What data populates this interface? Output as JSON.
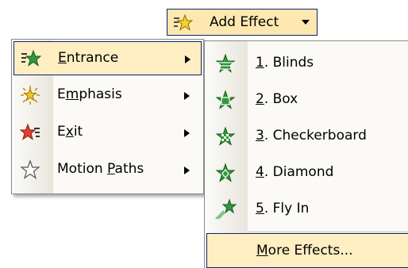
{
  "add_effect": {
    "label": "Add Effect",
    "icon": "add-effect-star-icon"
  },
  "main_menu": {
    "items": [
      {
        "pre": "",
        "key": "E",
        "post": "ntrance",
        "icon": "entrance-star-icon",
        "has_submenu": true,
        "selected": true
      },
      {
        "pre": "E",
        "key": "m",
        "post": "phasis",
        "icon": "emphasis-star-icon",
        "has_submenu": true,
        "selected": false
      },
      {
        "pre": "E",
        "key": "x",
        "post": "it",
        "icon": "exit-star-icon",
        "has_submenu": true,
        "selected": false
      },
      {
        "pre": "Motion ",
        "key": "P",
        "post": "aths",
        "icon": "motion-path-star-icon",
        "has_submenu": true,
        "selected": false
      }
    ]
  },
  "sub_menu": {
    "items": [
      {
        "key": "1",
        "post": ". Blinds",
        "icon": "blinds-effect-icon"
      },
      {
        "key": "2",
        "post": ". Box",
        "icon": "box-effect-icon"
      },
      {
        "key": "3",
        "post": ". Checkerboard",
        "icon": "checkerboard-effect-icon"
      },
      {
        "key": "4",
        "post": ". Diamond",
        "icon": "diamond-effect-icon"
      },
      {
        "key": "5",
        "post": ". Fly In",
        "icon": "fly-in-effect-icon"
      }
    ],
    "more": {
      "pre": "",
      "key": "M",
      "post": "ore Effects..."
    }
  },
  "colors": {
    "highlight": "#ffeec2",
    "highlight_border": "#0a246a",
    "entrance_green": "#2f9a3a",
    "emphasis_yellow": "#f2c81e",
    "exit_red": "#e0402a"
  }
}
